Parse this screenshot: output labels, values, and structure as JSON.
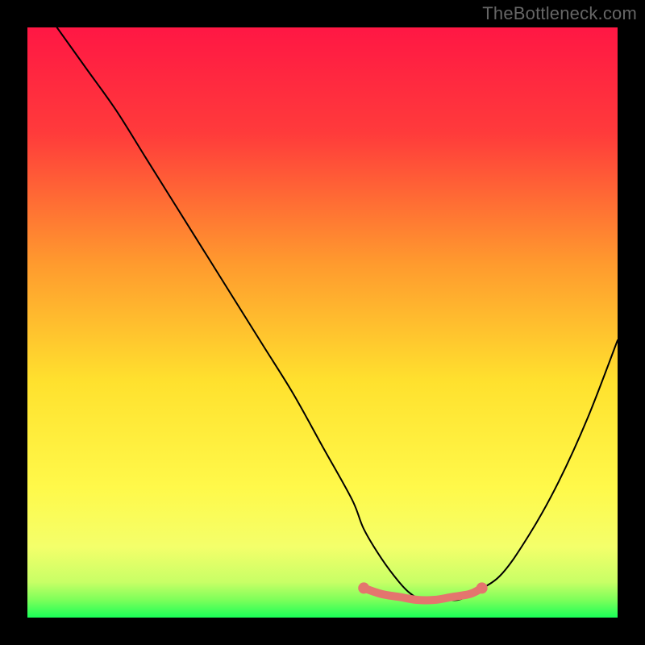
{
  "watermark": "TheBottleneck.com",
  "chart_data": {
    "type": "line",
    "title": "",
    "xlabel": "",
    "ylabel": "",
    "xlim": [
      0,
      100
    ],
    "ylim": [
      0,
      100
    ],
    "series": [
      {
        "name": "bottleneck-curve",
        "x": [
          5,
          10,
          15,
          20,
          25,
          30,
          35,
          40,
          45,
          50,
          55,
          57,
          60,
          63,
          65,
          67,
          70,
          73,
          75,
          80,
          85,
          90,
          95,
          100
        ],
        "values": [
          100,
          93,
          86,
          78,
          70,
          62,
          54,
          46,
          38,
          29,
          20,
          15,
          10,
          6,
          4,
          3,
          3,
          3,
          4,
          7,
          14,
          23,
          34,
          47
        ]
      },
      {
        "name": "optimal-zone-marker",
        "x": [
          57,
          60,
          63,
          66,
          69,
          72,
          75,
          77
        ],
        "values": [
          5,
          4,
          3.5,
          3,
          3,
          3.5,
          4,
          5
        ]
      }
    ],
    "gradient_stops": [
      {
        "offset": 0.0,
        "color": "#ff1744"
      },
      {
        "offset": 0.18,
        "color": "#ff3b3b"
      },
      {
        "offset": 0.4,
        "color": "#ff9a2e"
      },
      {
        "offset": 0.6,
        "color": "#ffe12e"
      },
      {
        "offset": 0.78,
        "color": "#fff94a"
      },
      {
        "offset": 0.88,
        "color": "#f4ff6a"
      },
      {
        "offset": 0.94,
        "color": "#c8ff66"
      },
      {
        "offset": 0.97,
        "color": "#7dff5a"
      },
      {
        "offset": 1.0,
        "color": "#1aff58"
      }
    ]
  }
}
